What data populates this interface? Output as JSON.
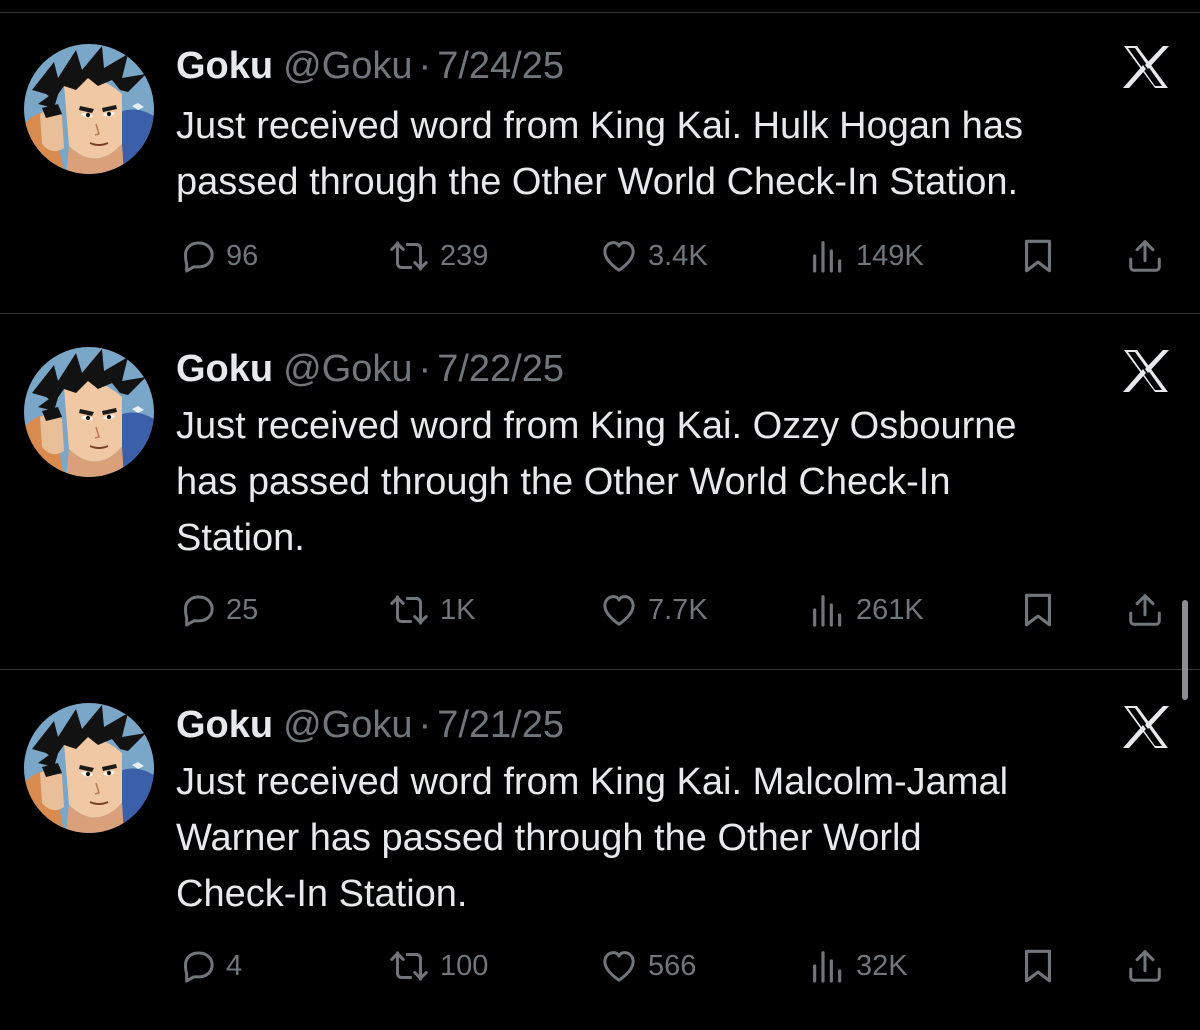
{
  "tweets": [
    {
      "name": "Goku",
      "handle": "@Goku",
      "separator": "·",
      "date": "7/24/25",
      "text": "Just received word from King Kai. Hulk Hogan has\npassed through the Other World Check-In Station.",
      "replies": "96",
      "reposts": "239",
      "likes": "3.4K",
      "views": "149K"
    },
    {
      "name": "Goku",
      "handle": "@Goku",
      "separator": "·",
      "date": "7/22/25",
      "text": "Just received word from King Kai. Ozzy Osbourne\nhas passed through the Other World Check-In\nStation.",
      "replies": "25",
      "reposts": "1K",
      "likes": "7.7K",
      "views": "261K"
    },
    {
      "name": "Goku",
      "handle": "@Goku",
      "separator": "·",
      "date": "7/21/25",
      "text": "Just received word from King Kai. Malcolm-Jamal\nWarner has passed through the Other World\nCheck-In Station.",
      "replies": "4",
      "reposts": "100",
      "likes": "566",
      "views": "32K"
    }
  ],
  "icons": {
    "logo": "x-logo-icon",
    "reply": "reply-icon",
    "repost": "repost-icon",
    "like": "heart-icon",
    "views": "views-icon",
    "bookmark": "bookmark-icon",
    "share": "share-icon"
  },
  "colors": {
    "background": "#000000",
    "text_primary": "#e7e9ea",
    "text_secondary": "#71767b",
    "divider": "#2f3336"
  }
}
